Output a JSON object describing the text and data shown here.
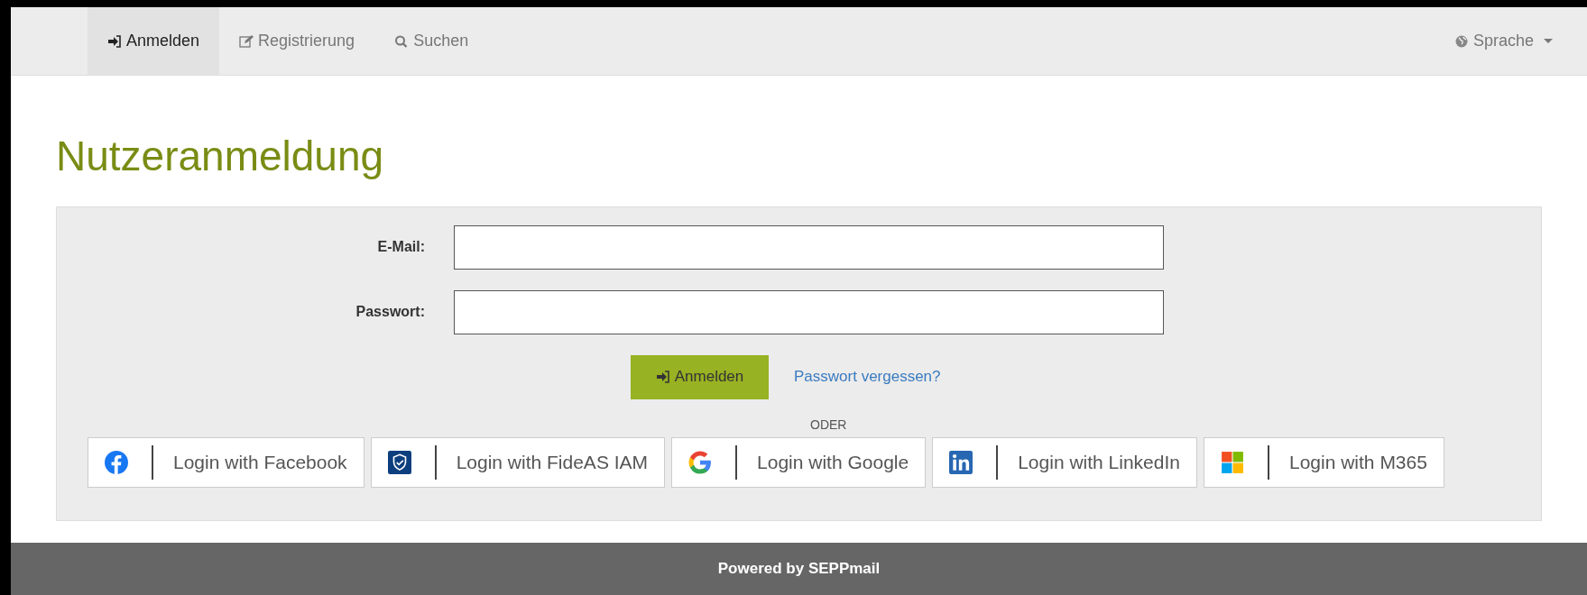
{
  "nav": {
    "tabs": [
      {
        "label": "Anmelden",
        "kind": "signin",
        "selected": true
      },
      {
        "label": "Registrierung",
        "kind": "edit",
        "selected": false
      },
      {
        "label": "Suchen",
        "kind": "search",
        "selected": false
      }
    ],
    "language": "Sprache"
  },
  "title": "Nutzeranmeldung",
  "form": {
    "fields": [
      {
        "label": "E-Mail:"
      },
      {
        "label": "Passwort:"
      }
    ],
    "submit": "Anmelden",
    "forgot": "Passwort vergessen?",
    "separator": "ODER",
    "providers": [
      {
        "label": "Login with Facebook",
        "kind": "facebook"
      },
      {
        "label": "Login with FideAS IAM",
        "kind": "fideas"
      },
      {
        "label": "Login with Google",
        "kind": "google"
      },
      {
        "label": "Login with LinkedIn",
        "kind": "linkedin"
      },
      {
        "label": "Login with M365",
        "kind": "microsoft"
      }
    ]
  },
  "footer": "Powered by SEPPmail"
}
